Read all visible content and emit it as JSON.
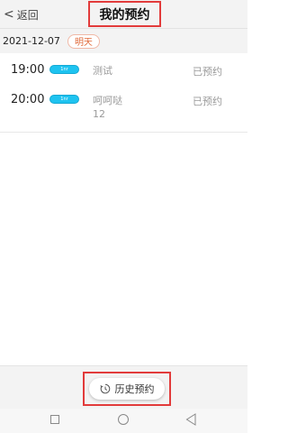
{
  "header": {
    "back_label": "返回",
    "title": "我的预约"
  },
  "date_section": {
    "date": "2021-12-07",
    "day_label": "明天"
  },
  "reservations": [
    {
      "time": "19:00",
      "tag": "1nr",
      "desc_line1": "测试",
      "desc_line2": "",
      "status": "已预约"
    },
    {
      "time": "20:00",
      "tag": "1nr",
      "desc_line1": "呵呵哒",
      "desc_line2": "12",
      "status": "已预约"
    }
  ],
  "footer": {
    "history_label": "历史预约"
  },
  "icons": {
    "back": "chevron-left-icon",
    "history": "clock-icon",
    "nav_recent": "square-icon",
    "nav_home": "circle-icon",
    "nav_back": "triangle-back-icon"
  },
  "colors": {
    "highlight": "#e23b3b",
    "tag": "#1ec3f0",
    "badge_text": "#e06a3a",
    "muted_text": "#9a9a9a"
  }
}
